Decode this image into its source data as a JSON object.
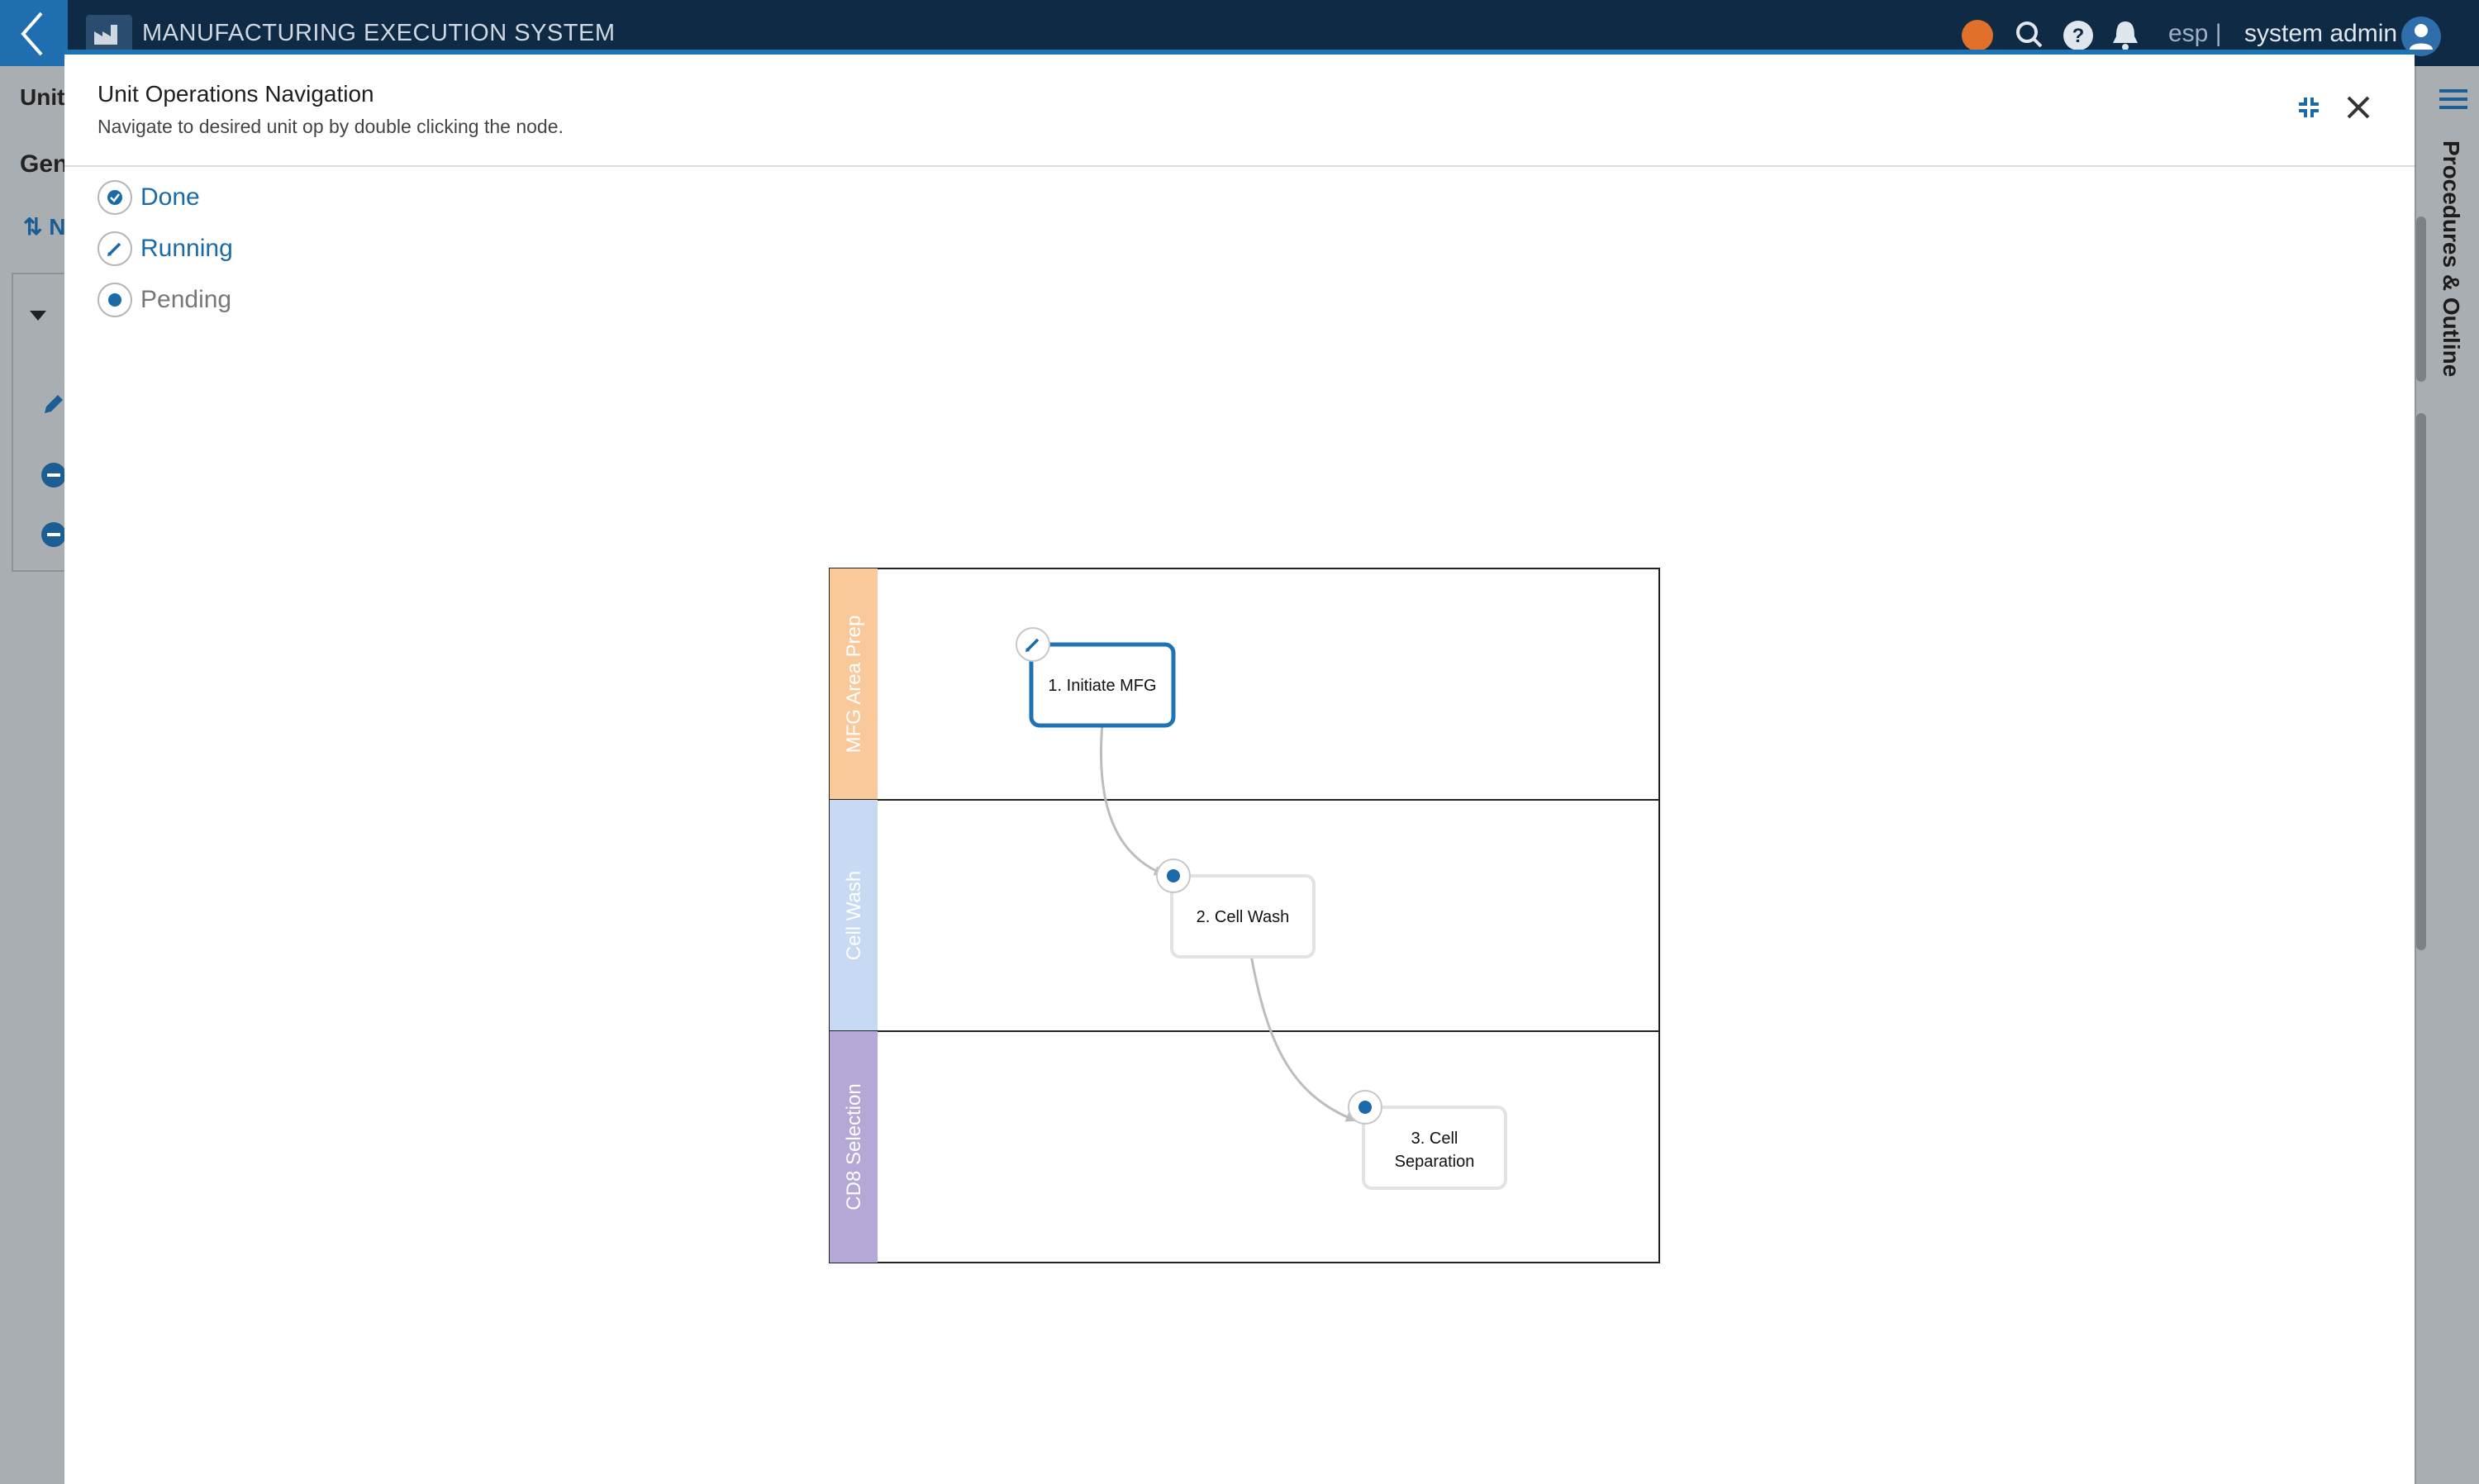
{
  "app": {
    "title": "MANUFACTURING EXECUTION SYSTEM",
    "tenant": "esp |",
    "user": "system admin",
    "status_color": "#e0702a",
    "accent": "#1e73b4"
  },
  "background": {
    "tab_fragment": "Unit",
    "heading_fragment": "Gen",
    "sort_fragment": "N",
    "right_panel_label": "Procedures & Outline"
  },
  "modal": {
    "title": "Unit Operations Navigation",
    "subtitle": "Navigate to desired unit op by double clicking the node.",
    "icons": {
      "collapse": "collapse-icon",
      "close": "close-icon"
    }
  },
  "legend": [
    {
      "label": "Done",
      "icon": "check-circle-icon"
    },
    {
      "label": "Running",
      "icon": "pencil-icon"
    },
    {
      "label": "Pending",
      "icon": "dot-icon"
    }
  ],
  "lanes": [
    {
      "label": "MFG Area Prep",
      "color": "#f9c99b"
    },
    {
      "label": "Cell Wash",
      "color": "#c8d9f3"
    },
    {
      "label": "CD8 Selection",
      "color": "#b6a8d6"
    }
  ],
  "nodes": [
    {
      "lines": [
        "1. Initiate MFG"
      ],
      "status": "running"
    },
    {
      "lines": [
        "2. Cell Wash"
      ],
      "status": "pending"
    },
    {
      "lines": [
        "3. Cell",
        "Separation"
      ],
      "status": "pending"
    }
  ]
}
